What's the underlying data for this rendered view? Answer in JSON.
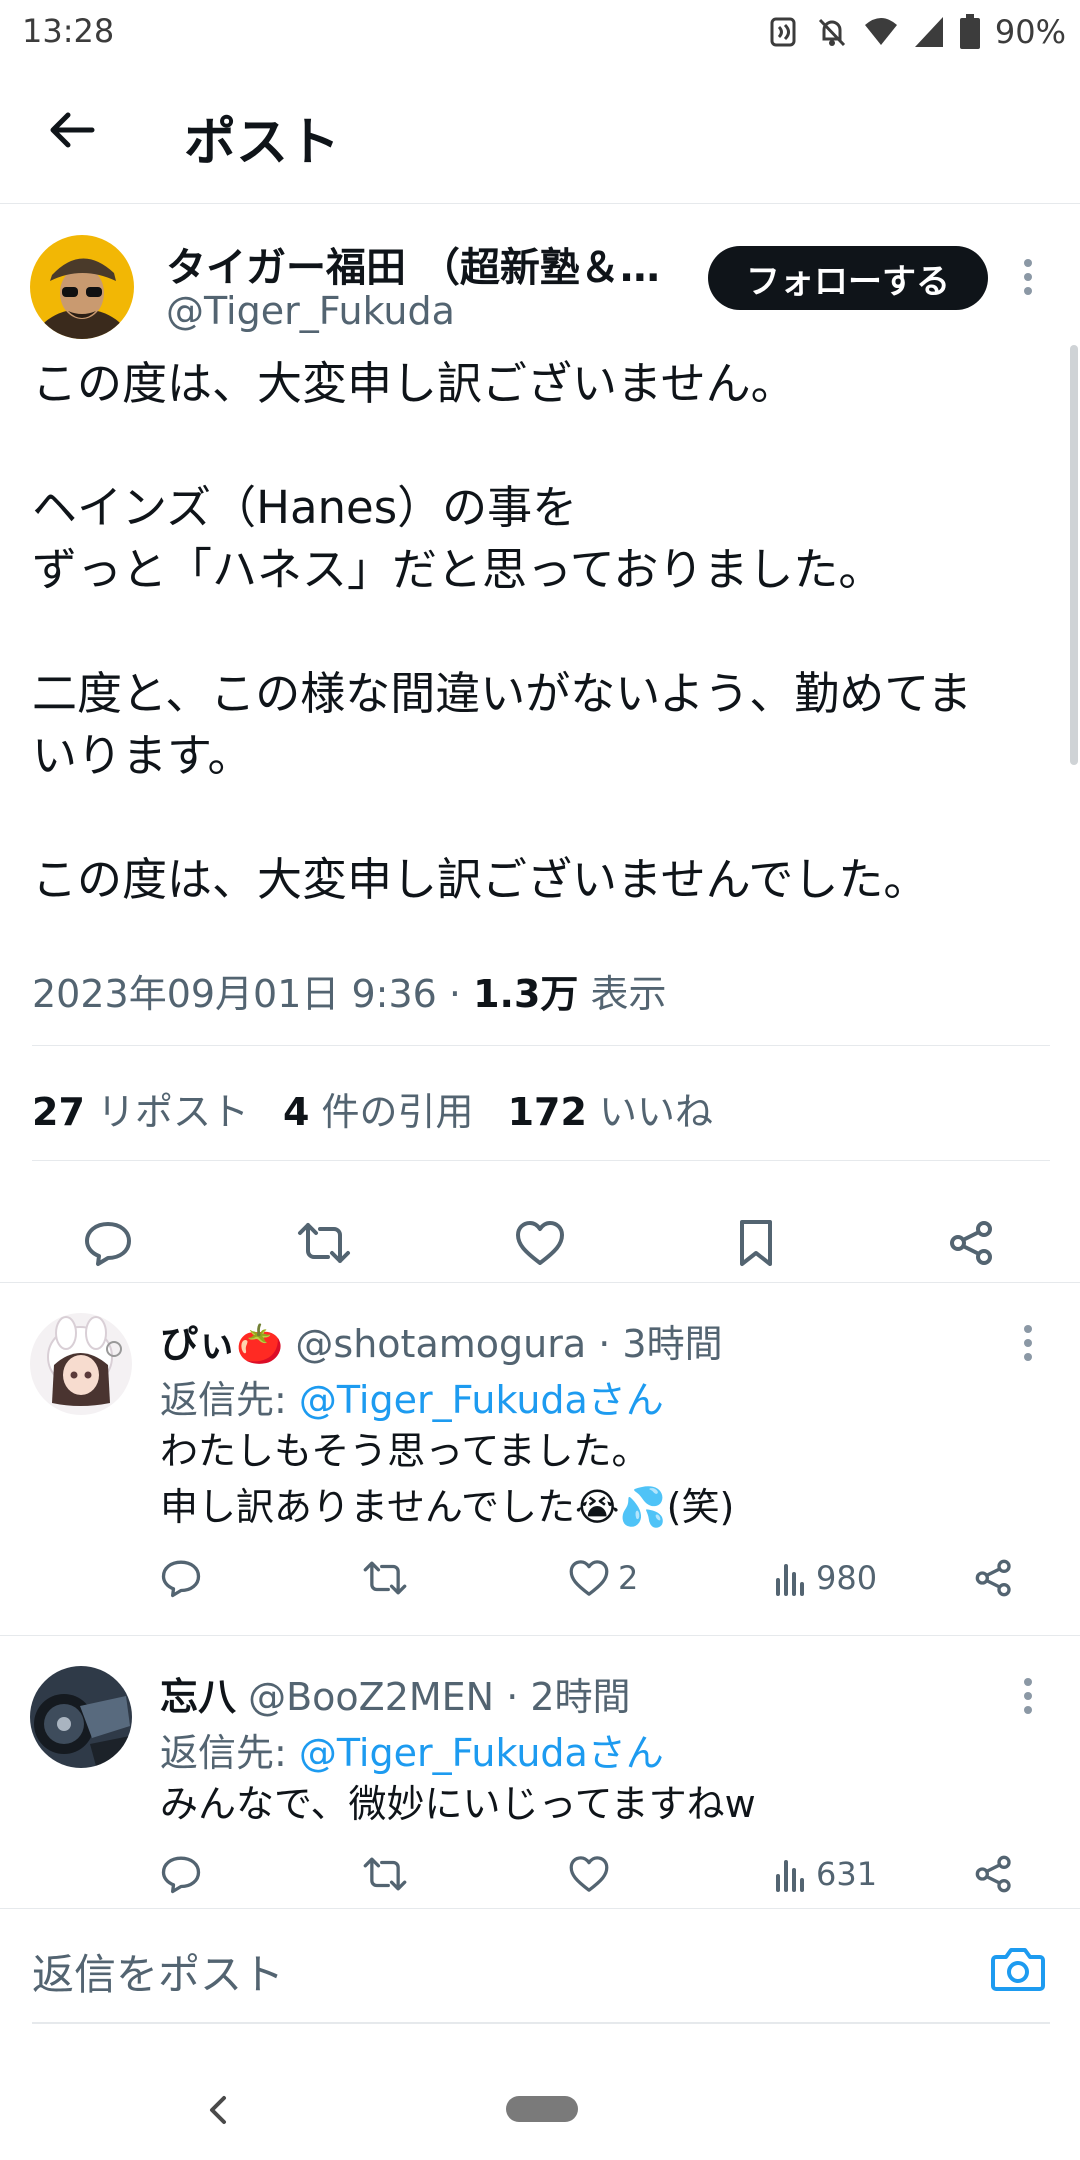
{
  "status_bar": {
    "time": "13:28",
    "battery": "90%"
  },
  "header": {
    "title": "ポスト"
  },
  "tweet": {
    "author_name": "タイガー福田 （超新塾＆…",
    "author_handle": "@Tiger_Fukuda",
    "follow_label": "フォローする",
    "lines": [
      "この度は、大変申し訳ございません。",
      "",
      "ヘインズ（Hanes）の事を",
      "ずっと「ハネス」だと思っておりました。",
      "",
      "二度と、この様な間違いがないよう、勤めてま",
      "いります。",
      "",
      "この度は、大変申し訳ございませんでした。"
    ],
    "timestamp": "2023年09月01日 9:36",
    "separator": " · ",
    "views_count": "1.3万",
    "views_label": "表示",
    "stats": {
      "reposts_count": "27",
      "reposts_label": "リポスト",
      "quotes_count": "4",
      "quotes_label": "件の引用",
      "likes_count": "172",
      "likes_label": "いいね"
    }
  },
  "replies": [
    {
      "name": "ぴぃ🍅",
      "handle": "@shotamogura",
      "time": "3時間",
      "replying_prefix": "返信先: ",
      "replying_to": "@Tiger_Fukudaさん",
      "lines": [
        "わたしもそう思ってました。",
        "申し訳ありませんでした😭💦(笑)"
      ],
      "likes": "2",
      "views": "980"
    },
    {
      "name": "忘八",
      "handle": "@BooZ2MEN",
      "time": "2時間",
      "replying_prefix": "返信先: ",
      "replying_to": "@Tiger_Fukudaさん",
      "lines": [
        "みんなで、微妙にいじってますねw"
      ],
      "likes": "",
      "views": "631"
    }
  ],
  "compose": {
    "placeholder": "返信をポスト"
  },
  "icons": {
    "back": "arrow-left-icon",
    "reply": "speech-bubble-icon",
    "repost": "repost-arrows-icon",
    "like": "heart-icon",
    "bookmark": "bookmark-icon",
    "share": "share-icon",
    "views": "bar-chart-icon",
    "camera": "camera-icon"
  },
  "colors": {
    "accent": "#1d9bf0",
    "text": "#0f1419",
    "secondary": "#536471",
    "follow_bg": "#0f1419"
  }
}
